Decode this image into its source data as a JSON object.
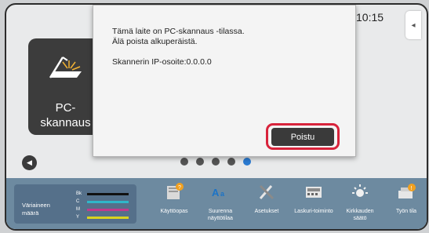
{
  "status": {
    "time": "10:15"
  },
  "side_tab": {
    "glyph": "◂"
  },
  "home_tile": {
    "label_line1": "PC-",
    "label_line2": "skannaus"
  },
  "nav": {
    "prev_glyph": "◀"
  },
  "pager": {
    "count": 5,
    "active_index": 4
  },
  "dialog": {
    "line1": "Tämä laite on PC-skannaus -tilassa.",
    "line2": "Älä poista alkuperäistä.",
    "ip_line": "Skannerin IP-osoite:0.0.0.0",
    "exit_label": "Poistu",
    "highlight_color": "#d8233b"
  },
  "toner": {
    "title": "Väriaineen määrä",
    "bars": [
      {
        "label": "Bk",
        "color": "#111111",
        "level": 1.0
      },
      {
        "label": "C",
        "color": "#2fb7c9",
        "level": 1.0
      },
      {
        "label": "M",
        "color": "#c23a8c",
        "level": 1.0
      },
      {
        "label": "Y",
        "color": "#d9d31f",
        "level": 1.0
      }
    ]
  },
  "tools": [
    {
      "label": "Käyttöopas",
      "icon": "book-icon"
    },
    {
      "label": "Suurenna näyttötilaa",
      "icon": "zoom-text-icon"
    },
    {
      "label": "Asetukset",
      "icon": "wrench-screwdriver-icon"
    },
    {
      "label": "Laskuri-toiminto",
      "icon": "calculator-icon"
    },
    {
      "label": "Kirkkauden säätö",
      "icon": "brightness-icon"
    },
    {
      "label": "Työn tila",
      "icon": "job-status-icon"
    }
  ],
  "colors": {
    "accent": "#2b7bd2",
    "panel": "#6d8aa0"
  }
}
